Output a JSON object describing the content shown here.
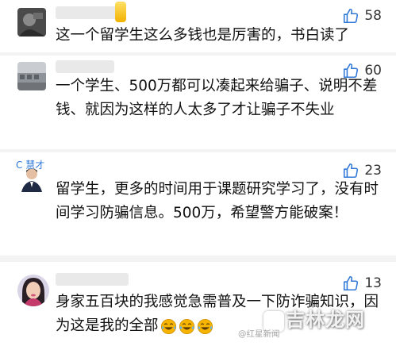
{
  "comments": [
    {
      "name": "",
      "likes": "58",
      "text": "这一个留学生这么多钱也是厉害的，书白读了"
    },
    {
      "name": "",
      "likes": "60",
      "text": "一个学生、500万都可以凑起来给骗子、说明不差钱、就因为这样的人太多了才让骗子不失业"
    },
    {
      "name": "C 慧才",
      "likes": "23",
      "text": "留学生，更多的时间用于课题研究学习了，没有时间学习防骗信息。500万，希望警方能破案！"
    },
    {
      "name": "",
      "likes": "13",
      "text": "身家五百块的我感觉急需普及一下防诈骗知识，因为这是我的全部",
      "emoji": [
        "grinning-tears-face",
        "grinning-tears-face",
        "grinning-tears-face"
      ]
    }
  ],
  "watermarks": {
    "weibo": "@红星新闻",
    "site": "吉林龙网"
  },
  "colors": {
    "like_icon": "#2f78d8",
    "emoji_yellow": "#f6b400"
  }
}
